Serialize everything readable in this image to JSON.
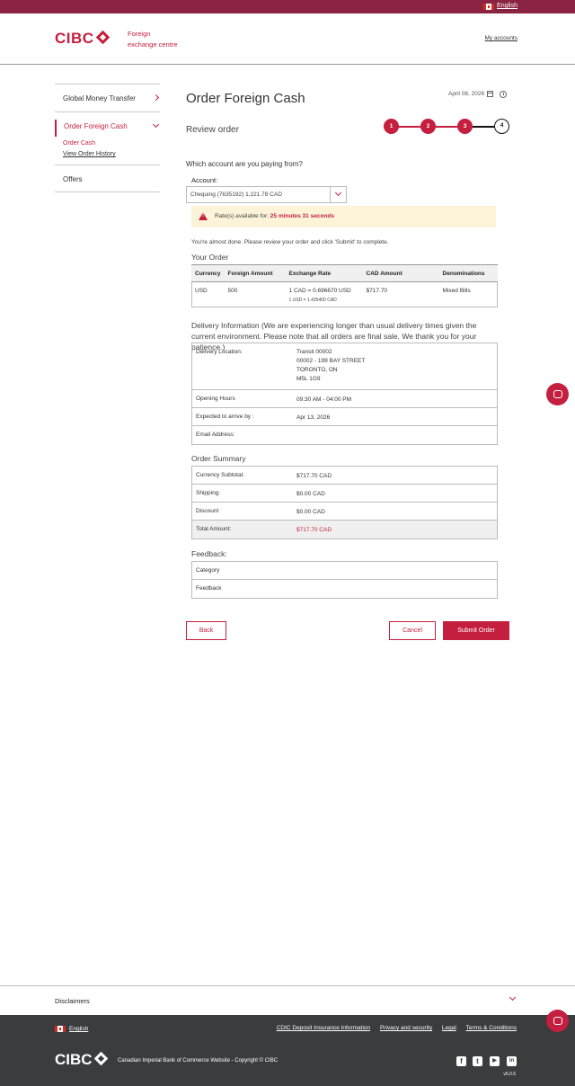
{
  "topbar": {
    "language": "English"
  },
  "header": {
    "brand": "CIBC",
    "tagline_line1": "Foreign",
    "tagline_line2": "exchange centre",
    "my_accounts": "My accounts"
  },
  "sidebar": {
    "items": [
      {
        "label": "Global Money Transfer"
      },
      {
        "label": "Order Foreign Cash"
      },
      {
        "label": "Order Cash"
      },
      {
        "label": "View Order History"
      },
      {
        "label": "Offers"
      }
    ]
  },
  "page": {
    "title": "Order Foreign Cash",
    "date": "April 08, 2026",
    "subtitle": "Review order",
    "steps": [
      "1",
      "2",
      "3",
      "4"
    ],
    "question": "Which account are you paying from?",
    "account_label": "Account:",
    "account_value": "Chequing (7635192) 1,221.78 CAD",
    "alert_prefix": "Rate(s) available for: ",
    "alert_time": "25 minutes 31 seconds",
    "almost_done": "You're almost done. Please review your order and click 'Submit' to complete.",
    "your_order_title": "Your Order"
  },
  "order_table": {
    "headers": [
      "Currency",
      "Foreign Amount",
      "Exchange Rate",
      "CAD Amount",
      "Denominations"
    ],
    "row": {
      "currency": "USD",
      "foreign_amount": "500",
      "rate": "1 CAD = 0.696670 USD",
      "rate_sub": "1 USD = 1.435400 CAD",
      "cad_amount": "$717.70",
      "denominations": "Mixed Bills"
    }
  },
  "delivery": {
    "title": "Delivery Information (We are experiencing longer than usual delivery times given the current environment. Please note that all orders are final sale. We thank you for your patience.)",
    "location_label": "Delivery Location:",
    "location_line1": "Transit 00002",
    "location_line2": "00002 - 199 BAY STREET",
    "location_line3": "TORONTO, ON",
    "location_line4": "M5L 1G9",
    "hours_label": "Opening Hours",
    "hours_value": "09:30 AM - 04:00 PM",
    "arrive_label": "Expected to arrive by :",
    "arrive_value": "Apr 13, 2026",
    "email_label": "Email Address:",
    "email_value": ""
  },
  "summary": {
    "title": "Order Summary",
    "rows": [
      {
        "label": "Currency Subtotal:",
        "value": "$717.70 CAD"
      },
      {
        "label": "Shipping:",
        "value": "$0.00 CAD"
      },
      {
        "label": "Discount",
        "value": "$0.00 CAD"
      },
      {
        "label": "Total Amount:",
        "value": "$717.70 CAD"
      }
    ]
  },
  "feedback": {
    "title": "Feedback:",
    "rows": [
      {
        "label": "Category"
      },
      {
        "label": "Feedback"
      }
    ]
  },
  "buttons": {
    "back": "Back",
    "cancel": "Cancel",
    "submit": "Submit Order"
  },
  "footer": {
    "disclaimers": "Disclaimers",
    "language": "English",
    "links": [
      "CDIC Deposit Insurance Information",
      "Privacy and security",
      "Legal",
      "Terms & Conditions"
    ],
    "brand": "CIBC",
    "copyright": "Canadian Imperial Bank of Commerce Website - Copyright © CIBC",
    "social": [
      "f",
      "t",
      "▶",
      "in"
    ],
    "version": "v5.0.5"
  },
  "colors": {
    "brand_red": "#c41f3e",
    "topbar": "#8b2342",
    "footer_bg": "#3a3c3e"
  }
}
